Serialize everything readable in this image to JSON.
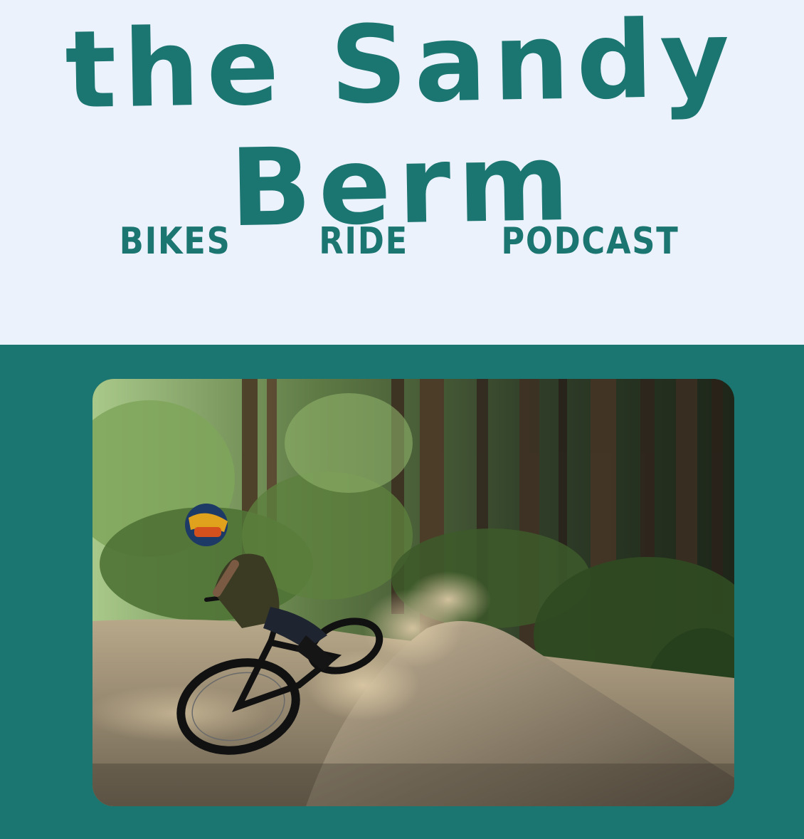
{
  "site": {
    "title": "the Sandy Berm"
  },
  "nav": {
    "items": [
      {
        "label": "BIKES"
      },
      {
        "label": "RIDE"
      },
      {
        "label": "PODCAST"
      }
    ]
  },
  "hero": {
    "image_subject": "mountain biker cornering on dirt berm in forest"
  },
  "colors": {
    "header_background": "#ebf2fb",
    "brand_teal": "#1b7570"
  }
}
